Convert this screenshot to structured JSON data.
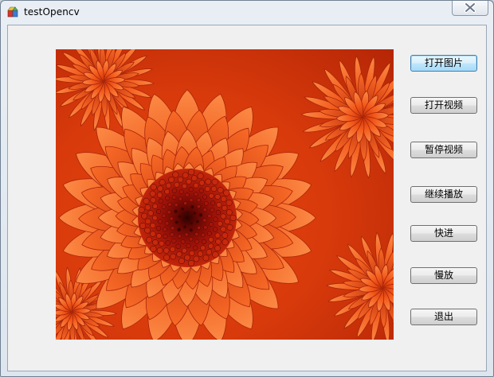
{
  "window": {
    "title": "testOpencv",
    "icon": "application-icon",
    "close_icon": "close-icon"
  },
  "display": {
    "content": "image",
    "subject": "orange chrysanthemum photo"
  },
  "buttons": {
    "open_image": "打开图片",
    "open_video": "打开视频",
    "pause_video": "暂停视频",
    "resume_play": "继续播放",
    "fast_forward": "快进",
    "slow_motion": "慢放",
    "exit": "退出"
  },
  "colors": {
    "flower_center": "#8a0b05",
    "flower_petal": "#f05a1a",
    "default_button_border": "#3c7fb1"
  }
}
